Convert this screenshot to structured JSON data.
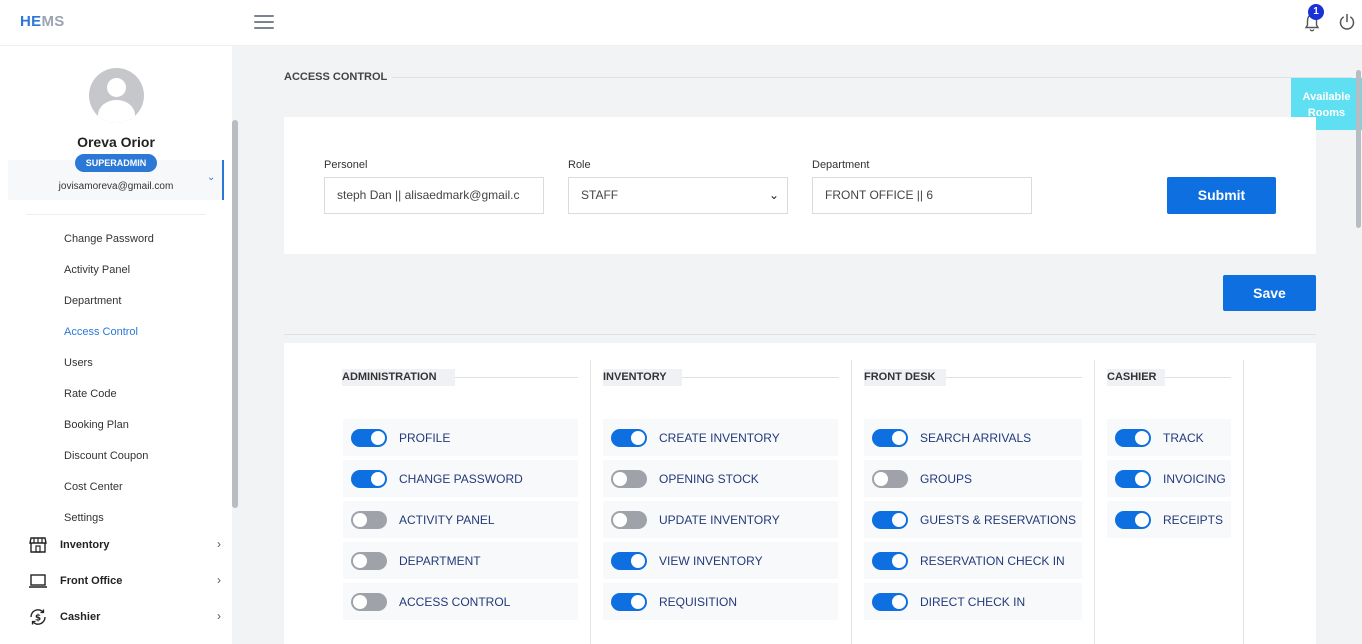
{
  "app": {
    "logo_he": "HE",
    "logo_ms": "MS"
  },
  "header": {
    "notification_count": "1"
  },
  "user": {
    "name": "Oreva Orior",
    "role": "SUPERADMIN",
    "email": "jovisamoreva@gmail.com"
  },
  "sidebar": {
    "sub_items": [
      {
        "label": "Change Password"
      },
      {
        "label": "Activity Panel"
      },
      {
        "label": "Department"
      },
      {
        "label": "Access Control"
      },
      {
        "label": "Users"
      },
      {
        "label": "Rate Code"
      },
      {
        "label": "Booking Plan"
      },
      {
        "label": "Discount Coupon"
      },
      {
        "label": "Cost Center"
      },
      {
        "label": "Settings"
      }
    ],
    "main_items": [
      {
        "label": "Inventory",
        "icon": "store-icon"
      },
      {
        "label": "Front Office",
        "icon": "laptop-icon"
      },
      {
        "label": "Cashier",
        "icon": "cashier-icon"
      }
    ]
  },
  "page": {
    "title": "ACCESS CONTROL",
    "available_rooms": "Available Rooms"
  },
  "form": {
    "personel_label": "Personel",
    "personel_value": "steph Dan || alisaedmark@gmail.c",
    "role_label": "Role",
    "role_value": "STAFF",
    "department_label": "Department",
    "department_value": "FRONT OFFICE || 6",
    "submit_label": "Submit",
    "save_label": "Save"
  },
  "sections": [
    {
      "title": "ADMINISTRATION",
      "items": [
        {
          "label": "PROFILE",
          "on": true
        },
        {
          "label": "CHANGE PASSWORD",
          "on": true
        },
        {
          "label": "ACTIVITY PANEL",
          "on": false
        },
        {
          "label": "DEPARTMENT",
          "on": false
        },
        {
          "label": "ACCESS CONTROL",
          "on": false
        }
      ]
    },
    {
      "title": "INVENTORY",
      "items": [
        {
          "label": "CREATE INVENTORY",
          "on": true
        },
        {
          "label": "OPENING STOCK",
          "on": false
        },
        {
          "label": "UPDATE INVENTORY",
          "on": false
        },
        {
          "label": "VIEW INVENTORY",
          "on": true
        },
        {
          "label": "REQUISITION",
          "on": true
        }
      ]
    },
    {
      "title": "FRONT DESK",
      "items": [
        {
          "label": "SEARCH ARRIVALS",
          "on": true
        },
        {
          "label": "GROUPS",
          "on": false
        },
        {
          "label": "GUESTS & RESERVATIONS",
          "on": true
        },
        {
          "label": "RESERVATION CHECK IN",
          "on": true
        },
        {
          "label": "DIRECT CHECK IN",
          "on": true
        }
      ]
    },
    {
      "title": "CASHIER",
      "items": [
        {
          "label": "TRACK",
          "on": true
        },
        {
          "label": "INVOICING",
          "on": true
        },
        {
          "label": "RECEIPTS",
          "on": true
        }
      ]
    }
  ]
}
